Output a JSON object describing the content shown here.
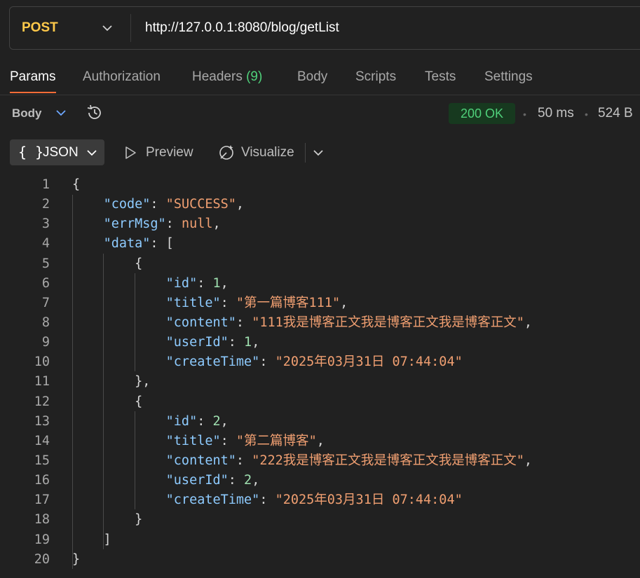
{
  "request": {
    "method": "POST",
    "url": "http://127.0.0.1:8080/blog/getList"
  },
  "tabs": [
    {
      "label": "Params",
      "active": true
    },
    {
      "label": "Authorization"
    },
    {
      "label": "Headers",
      "count": "(9)"
    },
    {
      "label": "Body"
    },
    {
      "label": "Scripts"
    },
    {
      "label": "Tests"
    },
    {
      "label": "Settings"
    }
  ],
  "response": {
    "body_label": "Body",
    "status": "200 OK",
    "time": "50 ms",
    "size": "524 B",
    "format_braces": "{ }",
    "format": "JSON",
    "preview": "Preview",
    "visualize": "Visualize"
  },
  "code_lines": [
    "1",
    "2",
    "3",
    "4",
    "5",
    "6",
    "7",
    "8",
    "9",
    "10",
    "11",
    "12",
    "13",
    "14",
    "15",
    "16",
    "17",
    "18",
    "19",
    "20"
  ],
  "json": {
    "code": "SUCCESS",
    "errMsg": "null",
    "data": [
      {
        "id": "1",
        "title": "第一篇博客111",
        "content": "111我是博客正文我是博客正文我是博客正文",
        "userId": "1",
        "createTime": "2025年03月31日 07:44:04"
      },
      {
        "id": "2",
        "title": "第二篇博客",
        "content": "222我是博客正文我是博客正文我是博客正文",
        "userId": "2",
        "createTime": "2025年03月31日 07:44:04"
      }
    ]
  },
  "colors": {
    "method": "#ffc94a",
    "key": "#8ecbff",
    "string": "#f09f71",
    "number": "#9fe0b0",
    "status": "#4fd07a",
    "accent": "#ff6c37"
  }
}
